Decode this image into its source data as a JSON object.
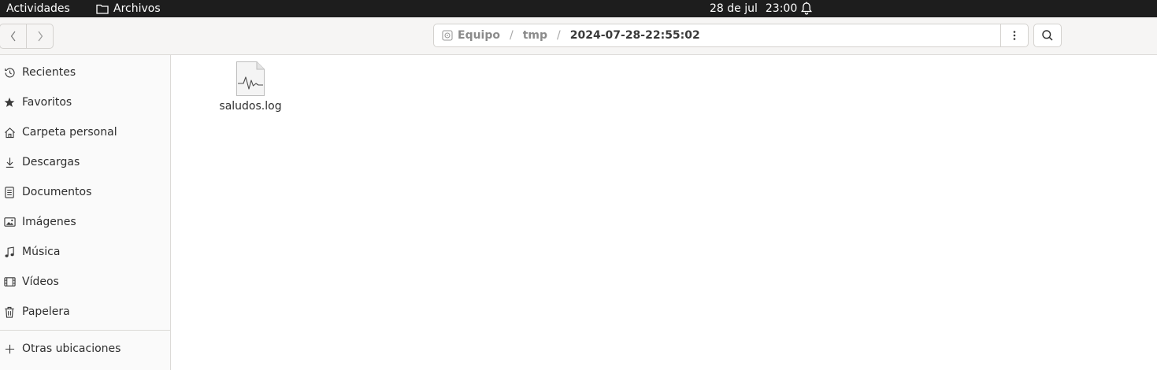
{
  "topbar": {
    "activities": "Actividades",
    "app_name": "Archivos",
    "date": "28 de jul",
    "time": "23:00"
  },
  "header": {
    "path": {
      "root": "Equipo",
      "sep1": "/",
      "folder": "tmp",
      "sep2": "/",
      "current": "2024-07-28-22:55:02"
    }
  },
  "sidebar": {
    "items": [
      {
        "label": "Recientes",
        "icon": "clock-icon"
      },
      {
        "label": "Favoritos",
        "icon": "star-icon"
      },
      {
        "label": "Carpeta personal",
        "icon": "home-icon"
      },
      {
        "label": "Descargas",
        "icon": "download-icon"
      },
      {
        "label": "Documentos",
        "icon": "document-icon"
      },
      {
        "label": "Imágenes",
        "icon": "image-icon"
      },
      {
        "label": "Música",
        "icon": "music-icon"
      },
      {
        "label": "Vídeos",
        "icon": "video-icon"
      },
      {
        "label": "Papelera",
        "icon": "trash-icon"
      }
    ],
    "other_locations": "Otras ubicaciones"
  },
  "files": [
    {
      "name": "saludos.log",
      "icon": "log-file-icon"
    }
  ]
}
